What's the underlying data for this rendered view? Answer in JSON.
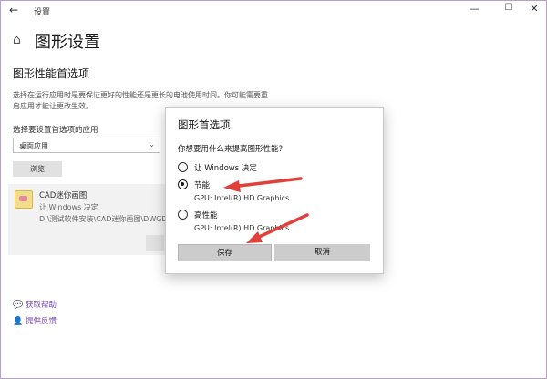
{
  "window": {
    "title": "设置",
    "back_glyph": "←",
    "minimize_glyph": "—",
    "maximize_glyph": "☐",
    "close_glyph": "✕"
  },
  "page": {
    "home_glyph": "⌂",
    "title": "图形设置",
    "section_title": "图形性能首选项",
    "description": "选择在运行应用时是要保证更好的性能还是更长的电池使用时间。你可能需要重启应用才能让更改生效。",
    "select_label": "选择要设置首选项的应用",
    "select_value": "桌面应用",
    "select_arrow": "⌄",
    "browse_label": "浏览"
  },
  "app_entry": {
    "name": "CAD迷你画图",
    "preference": "让 Windows 决定",
    "path": "D:\\测试软件安装\\CAD迷你画图\\DWGD"
  },
  "help": {
    "get_help": "获取帮助",
    "feedback": "提供反馈",
    "get_help_icon": "help-chat-icon",
    "feedback_icon": "feedback-person-icon"
  },
  "dialog": {
    "title": "图形首选项",
    "question": "你想要用什么来提高图形性能?",
    "options": [
      {
        "label": "让 Windows 决定",
        "checked": false,
        "gpu": ""
      },
      {
        "label": "节能",
        "checked": true,
        "gpu": "GPU: Intel(R) HD Graphics"
      },
      {
        "label": "高性能",
        "checked": false,
        "gpu": "GPU: Intel(R) HD Graphics"
      }
    ],
    "save_label": "保存",
    "cancel_label": "取消"
  },
  "colors": {
    "annotation_arrow": "#e0403a",
    "link": "#7a4bb0",
    "button_bg": "#cccccc"
  }
}
